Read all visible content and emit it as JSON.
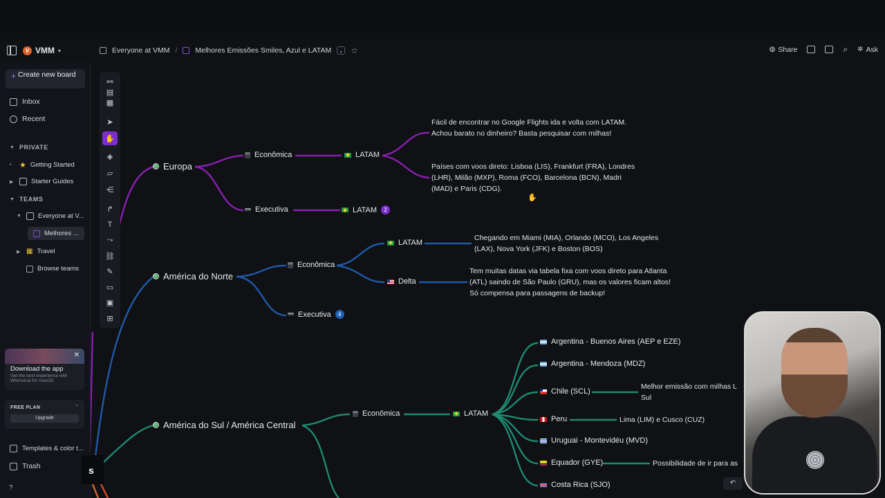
{
  "header": {
    "workspace": {
      "avatar_letter": "V",
      "name": "VMM"
    },
    "breadcrumb": {
      "team": "Everyone at VMM",
      "board": "Melhores Emissões Smiles, Azul e LATAM"
    },
    "share_label": "Share",
    "ask_label": "Ask"
  },
  "sidebar": {
    "create_label": "Create new board",
    "inbox_label": "Inbox",
    "recent_label": "Recent",
    "private_label": "PRIVATE",
    "private_items": [
      "Getting Started",
      "Starter Guides"
    ],
    "teams_label": "TEAMS",
    "team_name": "Everyone at V...",
    "active_board": "Melhores ...",
    "travel_label": "Travel",
    "browse_label": "Browse teams",
    "download": {
      "title": "Download the app",
      "subtitle": "Get the best experience with Whimsical for macOS"
    },
    "plan": {
      "label": "FREE PLAN",
      "upgrade": "Upgrade"
    },
    "templates_label": "Templates & color t...",
    "trash_label": "Trash",
    "help_label": "?"
  },
  "mindmap": {
    "europa": {
      "label": "Europa",
      "economica": "Econômica",
      "executiva": "Executiva",
      "latam1": "LATAM",
      "latam2": "LATAM",
      "badge": "2",
      "note1": "Fácil de encontrar no Google Flights ida e volta com LATAM. Achou barato no dinheiro? Basta pesquisar com milhas!",
      "note2": "Países com voos direto: Lisboa (LIS), Frankfurt (FRA), Londres (LHR), Milão (MXP), Roma (FCO), Barcelona (BCN), Madri (MAD) e Paris (CDG)."
    },
    "norte": {
      "label": "América do Norte",
      "economica": "Econômica",
      "executiva": "Executiva",
      "latam": "LATAM",
      "delta": "Delta",
      "badge": "4",
      "note_latam": "Chegando em Miami (MIA), Orlando (MCO), Los Angeles (LAX), Nova York (JFK) e Boston (BOS)",
      "note_delta": "Tem muitas datas via tabela fixa com voos direto para Atlanta (ATL) saindo de São Paulo (GRU), mas os valores ficam altos! Só compensa para passagens de backup!"
    },
    "sul": {
      "label": "América do Sul / América Central",
      "economica": "Econômica",
      "latam": "LATAM",
      "destinations": [
        "Argentina - Buenos Aires (AEP e EZE)",
        "Argentina - Mendoza (MDZ)",
        "Chile (SCL)",
        "Peru",
        "Uruguai - Montevidéu (MVD)",
        "Equador (GYE)",
        "Costa Rica (SJO)"
      ],
      "note_chile": "Melhor emissão com milhas L Sul",
      "note_peru": "Lima (LIM) e Cusco (CUZ)",
      "note_equador": "Possibilidade de ir para as"
    },
    "partial_label": "s"
  },
  "colors": {
    "europa": "#8a1fb0",
    "norte": "#1f5aa6",
    "sul": "#1e8a6e",
    "accent": "#7b2ecc"
  }
}
